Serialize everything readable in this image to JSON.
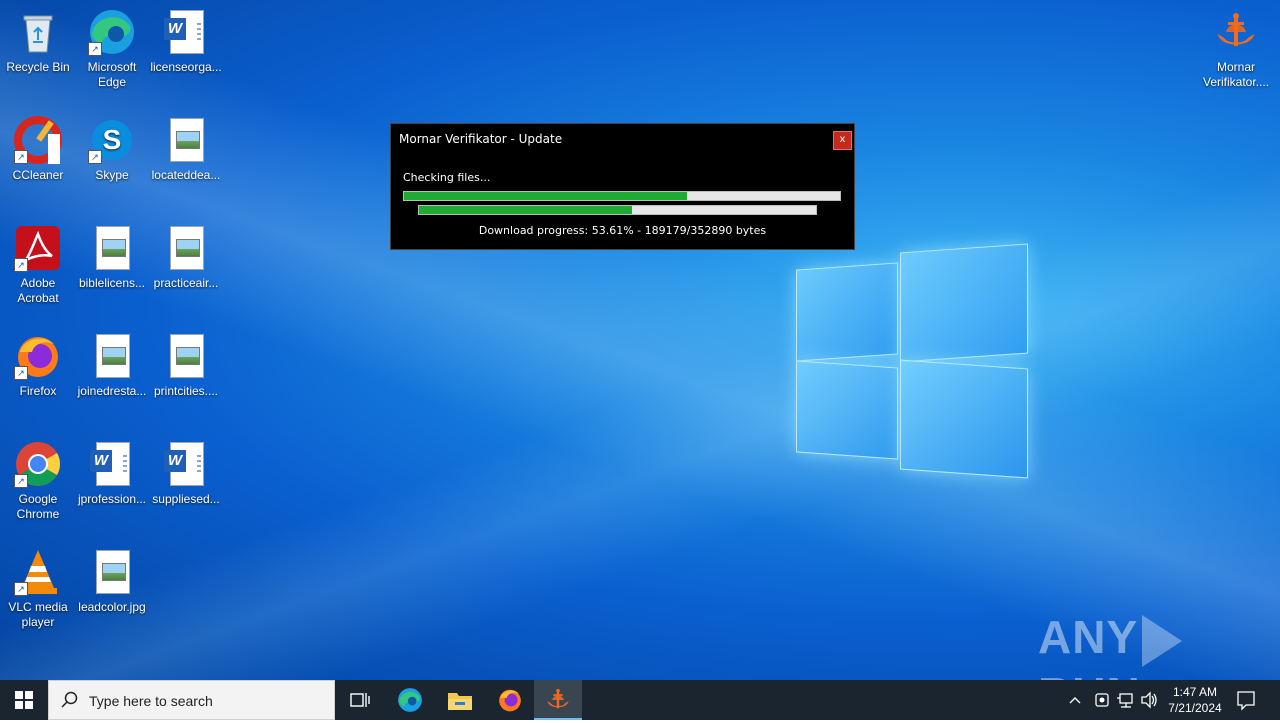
{
  "desktop": {
    "icons": [
      {
        "label": "Recycle Bin",
        "icon": "recycle-bin-icon"
      },
      {
        "label": "Microsoft Edge",
        "icon": "edge-icon"
      },
      {
        "label": "licenseorga...",
        "icon": "word-doc-icon"
      },
      {
        "label": "CCleaner",
        "icon": "ccleaner-icon"
      },
      {
        "label": "Skype",
        "icon": "skype-icon"
      },
      {
        "label": "locateddea...",
        "icon": "image-file-icon"
      },
      {
        "label": "Adobe Acrobat",
        "icon": "acrobat-icon"
      },
      {
        "label": "biblelicens...",
        "icon": "image-file-icon"
      },
      {
        "label": "practiceair...",
        "icon": "image-file-icon"
      },
      {
        "label": "Firefox",
        "icon": "firefox-icon"
      },
      {
        "label": "joinedresta...",
        "icon": "image-file-icon"
      },
      {
        "label": "printcities....",
        "icon": "image-file-icon"
      },
      {
        "label": "Google Chrome",
        "icon": "chrome-icon"
      },
      {
        "label": "jprofession...",
        "icon": "word-doc-icon"
      },
      {
        "label": "suppliesed...",
        "icon": "word-doc-icon"
      },
      {
        "label": "VLC media player",
        "icon": "vlc-icon"
      },
      {
        "label": "leadcolor.jpg",
        "icon": "image-file-icon"
      },
      {
        "label": "Mornar Verifikator....",
        "icon": "mornar-icon"
      }
    ]
  },
  "dialog": {
    "title": "Mornar Verifikator - Update",
    "close_label": "x",
    "status": "Checking files...",
    "progress1": 0.65,
    "progress2": 0.5361,
    "download_text": "Download progress: 53.61% - 189179/352890 bytes"
  },
  "watermark": {
    "left": "ANY",
    "right": "RUN"
  },
  "taskbar": {
    "search_placeholder": "Type here to search",
    "apps": [
      "task-view-icon",
      "edge-icon",
      "file-explorer-icon",
      "firefox-icon",
      "mornar-icon"
    ],
    "clock_time": "1:47 AM",
    "clock_date": "7/21/2024"
  },
  "colors": {
    "progress_fill": "#1faa34",
    "close_button": "#c42b1c",
    "accent_orange": "#f26a1b"
  }
}
